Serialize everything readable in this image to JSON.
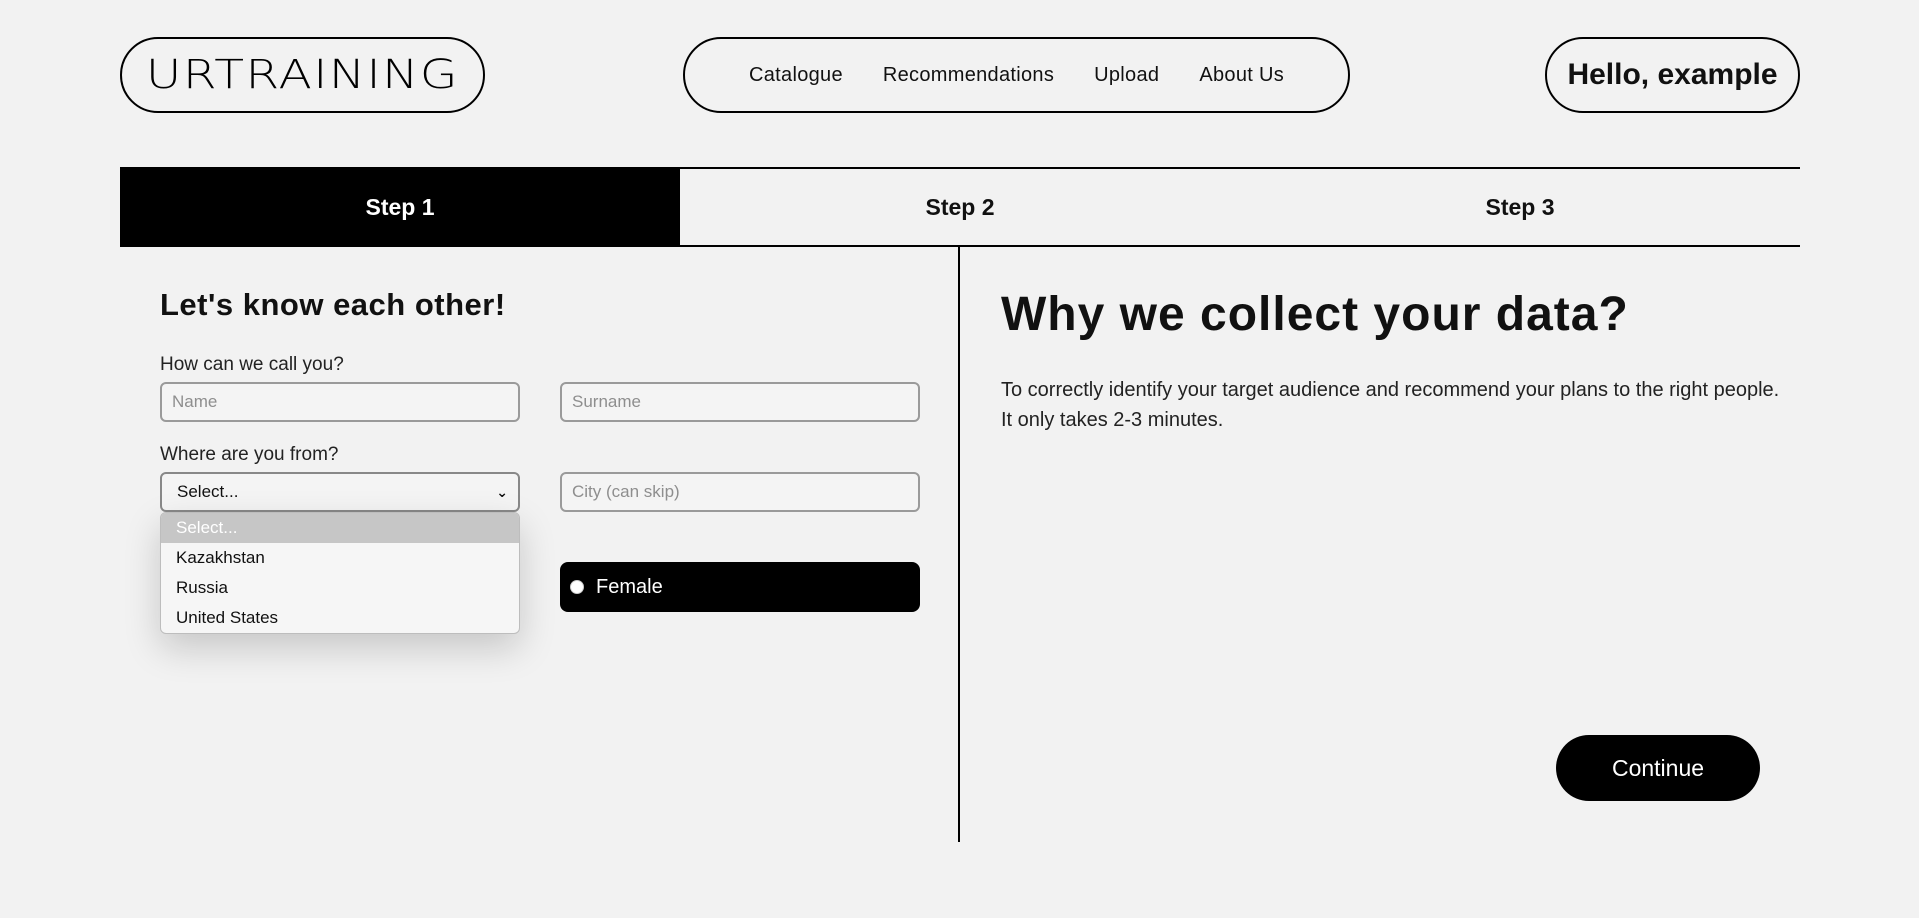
{
  "header": {
    "logo": "URTRAINING",
    "nav": [
      "Catalogue",
      "Recommendations",
      "Upload",
      "About Us"
    ],
    "greeting": "Hello, example"
  },
  "steps": [
    "Step 1",
    "Step 2",
    "Step 3"
  ],
  "active_step": "Step 1",
  "form": {
    "title": "Let's know each other!",
    "name_label": "How can we call you?",
    "name_placeholder": "Name",
    "surname_placeholder": "Surname",
    "location_label": "Where are you from?",
    "country_selected": "Select...",
    "city_placeholder": "City (can skip)",
    "gender_female": "Female",
    "country_options": [
      "Select...",
      "Kazakhstan",
      "Russia",
      "United States"
    ]
  },
  "info": {
    "title": "Why we collect your data?",
    "text": "To correctly identify your target audience and recommend your plans to the right people. It only takes 2-3 minutes.",
    "continue_label": "Continue"
  },
  "icons": {
    "select": "chevron-down-icon",
    "radio": "radio-button-icon"
  },
  "colors": {
    "background": "#f2f2f2",
    "accent": "#000000",
    "dropdown_highlight": "#c6c6c6"
  }
}
